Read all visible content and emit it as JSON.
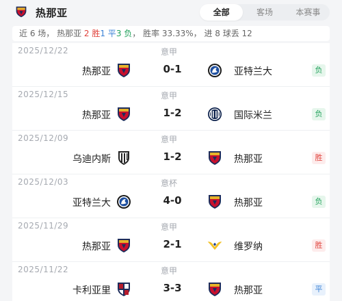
{
  "header": {
    "team_name": "热那亚",
    "tabs": [
      {
        "label": "全部",
        "active": true
      },
      {
        "label": "客场",
        "active": false
      },
      {
        "label": "本赛事",
        "active": false
      }
    ]
  },
  "summary": {
    "prefix": "近 6 场， 热那亚 ",
    "wins": "2 胜",
    "draws": "1 平",
    "losses": "3 负",
    "suffix": "， 胜率 33.33%， 进 8 球丢 12"
  },
  "colors": {
    "win": "#e0413a",
    "draw": "#3b82d6",
    "loss": "#21a15b"
  },
  "matches": [
    {
      "date": "2025/12/22",
      "competition": "意甲",
      "home": "热那亚",
      "home_logo": "genoa-crest",
      "score": "0-1",
      "away": "亚特兰大",
      "away_logo": "atalanta-crest",
      "result": "负",
      "result_type": "loss"
    },
    {
      "date": "2025/12/15",
      "competition": "意甲",
      "home": "热那亚",
      "home_logo": "genoa-crest",
      "score": "1-2",
      "away": "国际米兰",
      "away_logo": "inter-crest",
      "result": "负",
      "result_type": "loss"
    },
    {
      "date": "2025/12/09",
      "competition": "意甲",
      "home": "乌迪内斯",
      "home_logo": "udinese-crest",
      "score": "1-2",
      "away": "热那亚",
      "away_logo": "genoa-crest",
      "result": "胜",
      "result_type": "win"
    },
    {
      "date": "2025/12/03",
      "competition": "意杯",
      "home": "亚特兰大",
      "home_logo": "atalanta-crest",
      "score": "4-0",
      "away": "热那亚",
      "away_logo": "genoa-crest",
      "result": "负",
      "result_type": "loss"
    },
    {
      "date": "2025/11/29",
      "competition": "意甲",
      "home": "热那亚",
      "home_logo": "genoa-crest",
      "score": "2-1",
      "away": "维罗纳",
      "away_logo": "verona-crest",
      "result": "胜",
      "result_type": "win"
    },
    {
      "date": "2025/11/22",
      "competition": "意甲",
      "home": "卡利亚里",
      "home_logo": "cagliari-crest",
      "score": "3-3",
      "away": "热那亚",
      "away_logo": "genoa-crest",
      "result": "平",
      "result_type": "draw"
    }
  ]
}
